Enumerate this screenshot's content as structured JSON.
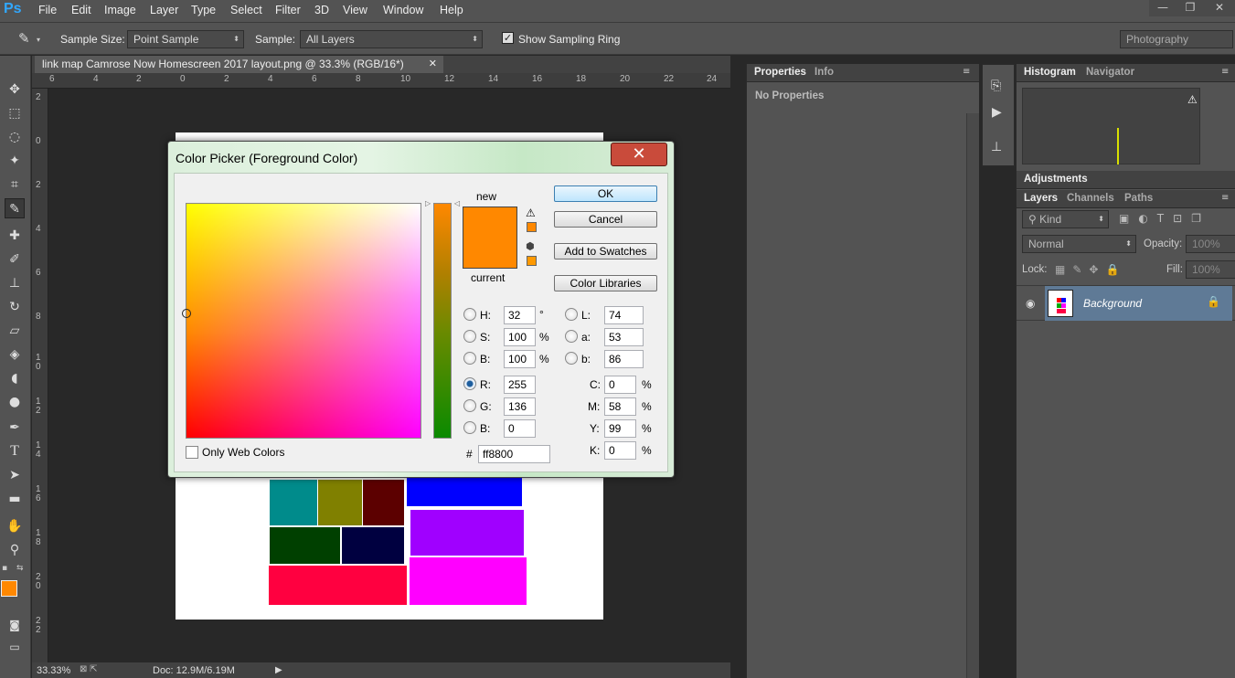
{
  "app": {
    "logo": "Ps"
  },
  "menu": [
    "File",
    "Edit",
    "Image",
    "Layer",
    "Type",
    "Select",
    "Filter",
    "3D",
    "View",
    "Window",
    "Help"
  ],
  "options": {
    "sample_size_label": "Sample Size:",
    "sample_size_value": "Point Sample",
    "sample_label": "Sample:",
    "sample_value": "All Layers",
    "ring_label": "Show Sampling Ring",
    "workspace": "Photography"
  },
  "document": {
    "tab_title": "link map Camrose Now Homescreen 2017 layout.png @ 33.3% (RGB/16*)",
    "zoom": "33.33%",
    "doc_size": "Doc: 12.9M/6.19M",
    "hruler_labels": [
      "6",
      "4",
      "2",
      "0",
      "2",
      "4",
      "6",
      "8",
      "10",
      "12",
      "14",
      "16",
      "18",
      "20",
      "22",
      "24"
    ],
    "vruler_labels": [
      "2",
      "0",
      "2",
      "4",
      "6",
      "8",
      "1 0",
      "1 2",
      "1 4",
      "1 6",
      "1 8",
      "2 0",
      "2 2"
    ]
  },
  "dialog": {
    "title": "Color Picker (Foreground Color)",
    "close_glyph": "✕",
    "new_label": "new",
    "current_label": "current",
    "new_color": "#ff8800",
    "current_color": "#ff8800",
    "buttons": {
      "ok": "OK",
      "cancel": "Cancel",
      "add_swatches": "Add to Swatches",
      "libraries": "Color Libraries"
    },
    "only_web": "Only Web Colors",
    "hsb": [
      {
        "label": "H:",
        "value": "32",
        "unit": "°"
      },
      {
        "label": "S:",
        "value": "100",
        "unit": "%"
      },
      {
        "label": "B:",
        "value": "100",
        "unit": "%"
      }
    ],
    "rgb": [
      {
        "label": "R:",
        "value": "255"
      },
      {
        "label": "G:",
        "value": "136"
      },
      {
        "label": "B:",
        "value": "0"
      }
    ],
    "lab": [
      {
        "label": "L:",
        "value": "74"
      },
      {
        "label": "a:",
        "value": "53"
      },
      {
        "label": "b:",
        "value": "86"
      }
    ],
    "cmyk": [
      {
        "label": "C:",
        "value": "0",
        "unit": "%"
      },
      {
        "label": "M:",
        "value": "58",
        "unit": "%"
      },
      {
        "label": "Y:",
        "value": "99",
        "unit": "%"
      },
      {
        "label": "K:",
        "value": "0",
        "unit": "%"
      }
    ],
    "hex_label": "#",
    "hex_value": "ff8800"
  },
  "properties_panel": {
    "tabs": [
      "Properties",
      "Info"
    ],
    "empty_text": "No Properties"
  },
  "histogram_panel": {
    "tabs": [
      "Histogram",
      "Navigator"
    ]
  },
  "adjustments_panel": {
    "title": "Adjustments"
  },
  "layers_panel": {
    "tabs": [
      "Layers",
      "Channels",
      "Paths"
    ],
    "kind_label": "Kind",
    "blend_mode": "Normal",
    "opacity_label": "Opacity:",
    "opacity_value": "100%",
    "lock_label": "Lock:",
    "fill_label": "Fill:",
    "fill_value": "100%",
    "layer_name": "Background"
  },
  "colors": {
    "accent": "#31a8ff",
    "foreground": "#ff8800"
  }
}
